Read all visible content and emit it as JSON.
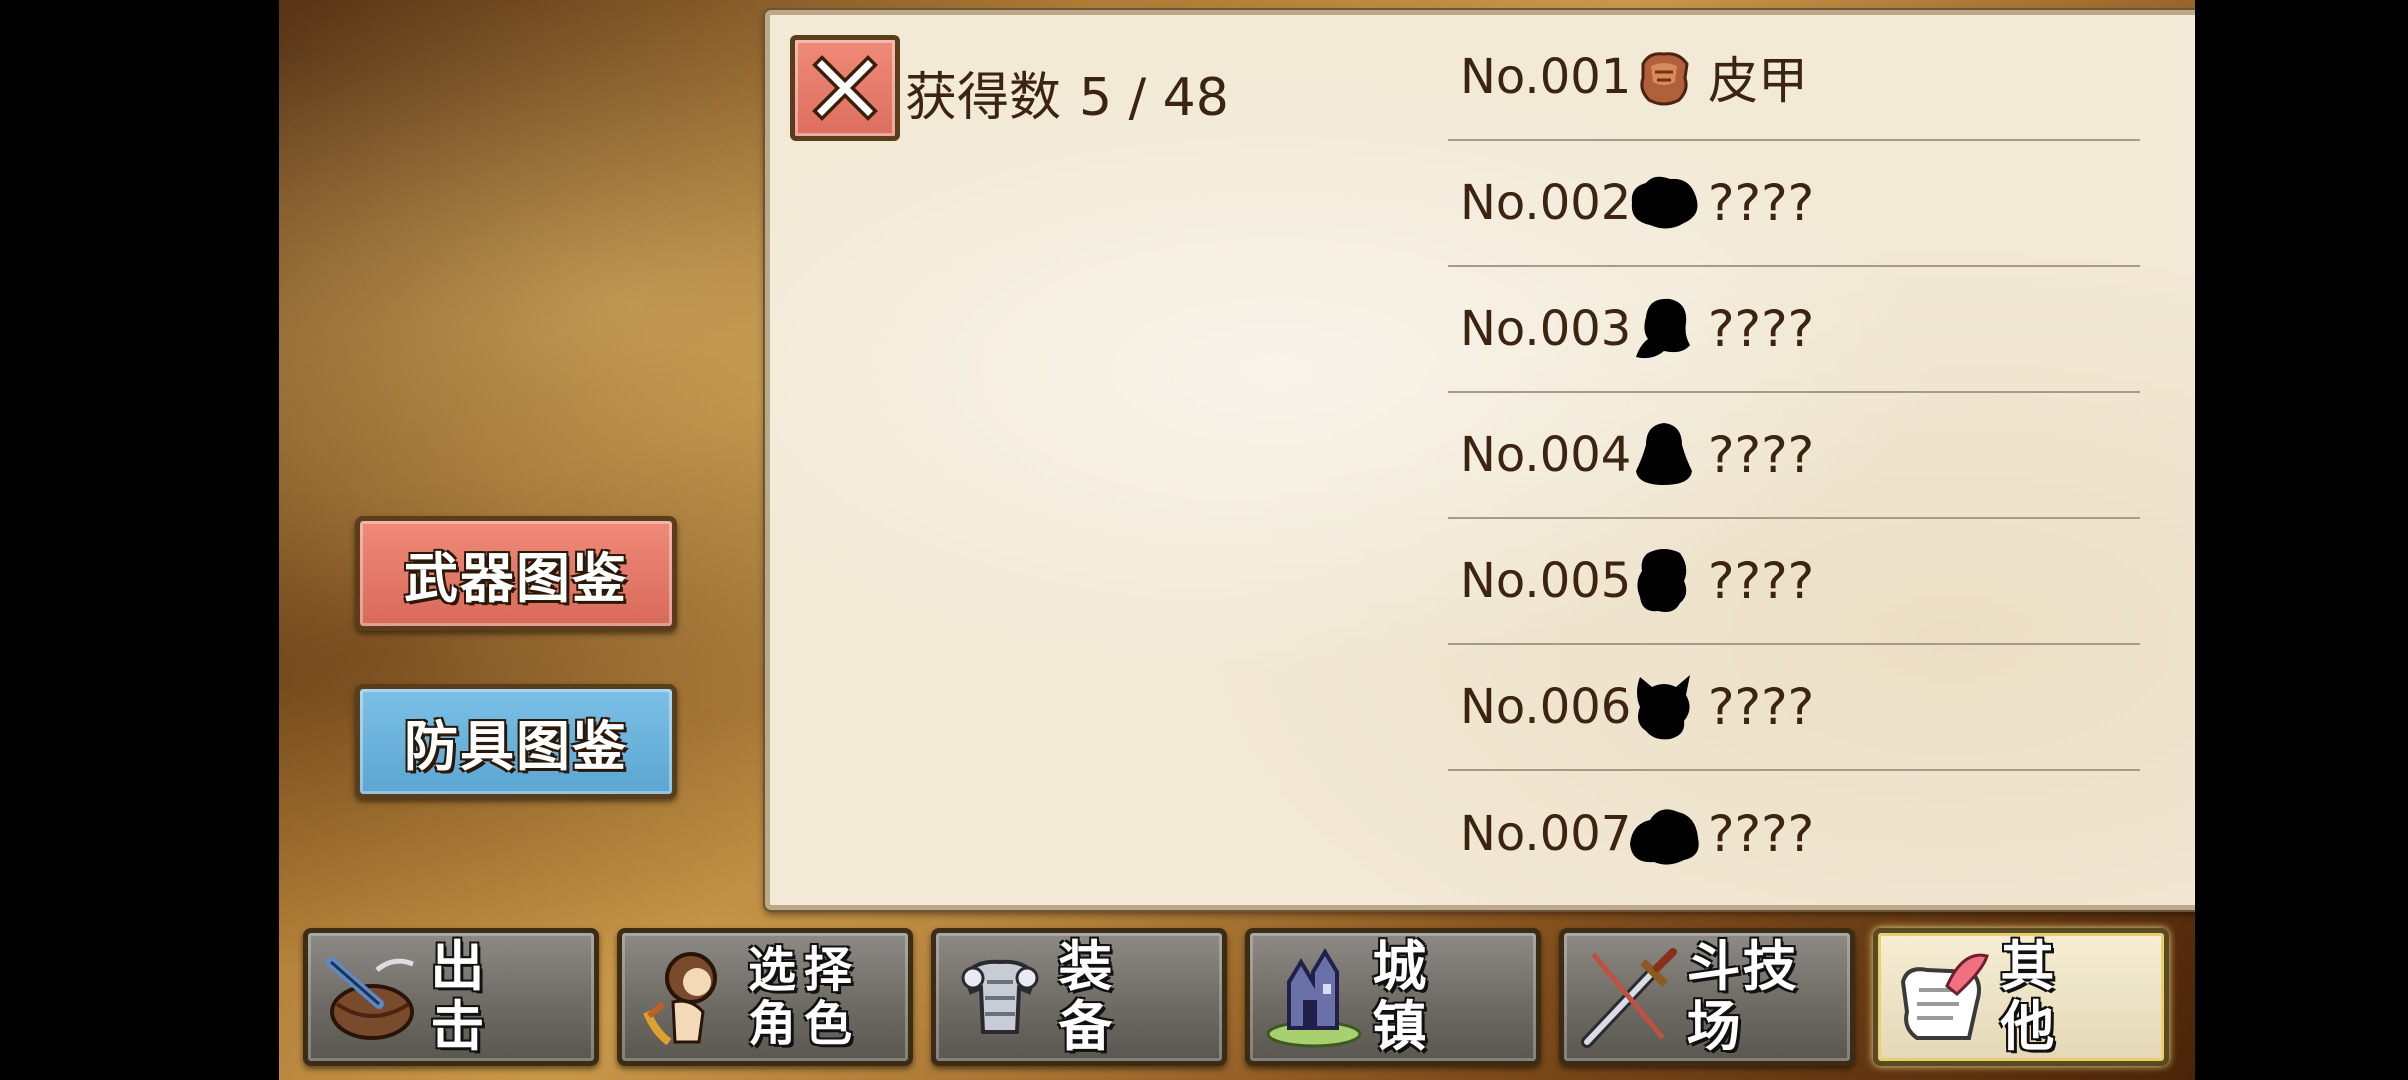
{
  "side_tabs": {
    "weapon_label": "武器图鉴",
    "armor_label": "防具图鉴"
  },
  "panel": {
    "count_title": "获得数",
    "count_value": "5 / 48",
    "items": [
      {
        "no": "No.001",
        "name": "皮甲",
        "icon": "leather-armor-icon",
        "known": true
      },
      {
        "no": "No.002",
        "name": "????",
        "icon": "unknown-silhouette-icon",
        "known": false
      },
      {
        "no": "No.003",
        "name": "????",
        "icon": "unknown-silhouette-icon",
        "known": false
      },
      {
        "no": "No.004",
        "name": "????",
        "icon": "unknown-silhouette-icon",
        "known": false
      },
      {
        "no": "No.005",
        "name": "????",
        "icon": "unknown-silhouette-icon",
        "known": false
      },
      {
        "no": "No.006",
        "name": "????",
        "icon": "unknown-silhouette-icon",
        "known": false
      },
      {
        "no": "No.007",
        "name": "????",
        "icon": "unknown-silhouette-icon",
        "known": false
      }
    ]
  },
  "bottom_nav": [
    {
      "label": "出 击",
      "icon": "pot-icon"
    },
    {
      "label": "选择\n角色",
      "icon": "character-icon"
    },
    {
      "label": "装 备",
      "icon": "armor-icon"
    },
    {
      "label": "城 镇",
      "icon": "castle-icon"
    },
    {
      "label": "斗技场",
      "icon": "sword-icon"
    },
    {
      "label": "其 他",
      "icon": "scroll-icon",
      "active": true
    }
  ],
  "colors": {
    "weapon_tab": "#e07868",
    "armor_tab": "#68b2dc",
    "close_button": "#e47a6a",
    "panel_bg": "#f2e9d6",
    "text_dark": "#3b2410"
  }
}
